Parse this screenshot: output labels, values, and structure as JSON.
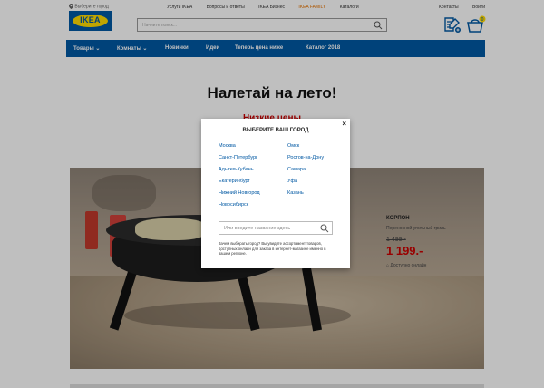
{
  "header": {
    "city_selector": "Выберите город",
    "logo_text": "IKEA",
    "top_links": [
      "Услуги IKEA",
      "Вопросы и ответы",
      "IKEA Бизнес",
      "IKEA FAMILY",
      "Каталоги"
    ],
    "right_links": [
      "Контакты",
      "Войти"
    ],
    "search_placeholder": "Начните поиск...",
    "icons": [
      "shopping-list-icon",
      "cart-icon"
    ],
    "cart_count": "0"
  },
  "nav": {
    "items": [
      "Товары",
      "Комнаты",
      "Новинки",
      "Идеи",
      "Теперь цена ниже",
      "Каталог 2018"
    ]
  },
  "hero": {
    "title": "Налетай на лето!",
    "subtitle": "Низкие цены"
  },
  "product": {
    "name": "КОРПОН",
    "description": "Переносной угольный гриль",
    "old_price": "1 499.-",
    "price": "1 199.-",
    "availability": "Доступно онлайн"
  },
  "modal": {
    "title": "ВЫБЕРИТЕ ВАШ ГОРОД",
    "close_label": "×",
    "cities_left": [
      "Москва",
      "Санкт-Петербург",
      "Адыгея-Кубань",
      "Екатеринбург",
      "Нижний Новгород",
      "Новосибирск"
    ],
    "cities_right": [
      "Омск",
      "Ростов-на-Дону",
      "Самара",
      "Уфа",
      "Казань"
    ],
    "search_placeholder": "Или введите название здесь",
    "note": "Зачем выбирать город? Вы увидите ассортимент товаров, доступных онлайн для заказа в интернет-магазине именно в вашем регионе."
  },
  "colors": {
    "ikea_blue": "#0058a3",
    "ikea_yellow": "#ffdb00",
    "price_red": "#cc0000",
    "family_orange": "#e67300"
  }
}
